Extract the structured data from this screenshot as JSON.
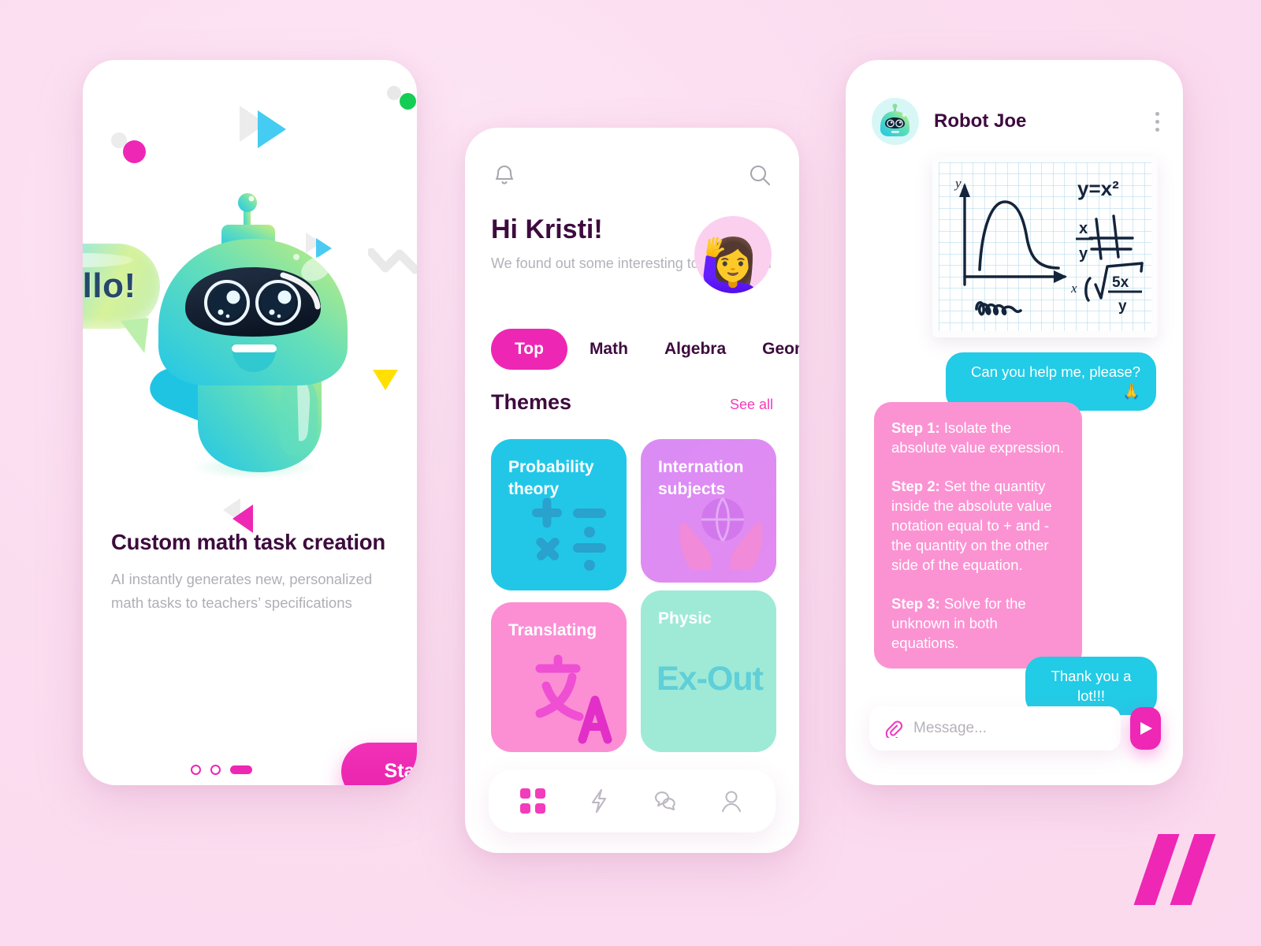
{
  "theme": {
    "background": "#fbdcef",
    "accent_pink": "#ed27b4",
    "deep_purple": "#3d0b3e",
    "cyan": "#22cbe6",
    "bubble_pink": "#fb93d2"
  },
  "onboarding": {
    "speech_bubble": "Hello!",
    "title": "Custom math task creation",
    "subtitle": "AI instantly generates new, personalized math tasks to teachers’ specifications",
    "start_label": "Start",
    "pagination": {
      "total": 3,
      "active_index": 2
    }
  },
  "home": {
    "icons": {
      "bell": "bell-icon",
      "search": "search-icon"
    },
    "greeting_title": "Hi Kristi!",
    "greeting_subtitle": "We found out some interesting topics for you",
    "avatar_emoji": "🙋‍♀️",
    "tabs": [
      {
        "label": "Top",
        "active": true
      },
      {
        "label": "Math",
        "active": false
      },
      {
        "label": "Algebra",
        "active": false
      },
      {
        "label": "Geometry",
        "active": false
      }
    ],
    "section_title": "Themes",
    "see_all_label": "See all",
    "cards": [
      {
        "title": "Probability theory",
        "icon": "math-operators-icon",
        "color": "#22c7e8"
      },
      {
        "title": "Internation subjects",
        "icon": "globe-in-hands-icon",
        "color": "#dc8cf3"
      },
      {
        "title": "Translating",
        "icon": "translate-icon",
        "color": "#fc8fd4"
      },
      {
        "title": "Physic",
        "icon": "ex-out-text",
        "color": "#9eead7",
        "badge_text": "Ex-Out"
      }
    ],
    "nav": [
      {
        "name": "dashboard",
        "icon": "grid-icon",
        "active": true
      },
      {
        "name": "activity",
        "icon": "lightning-icon",
        "active": false
      },
      {
        "name": "chats",
        "icon": "chat-bubbles-icon",
        "active": false
      },
      {
        "name": "profile",
        "icon": "person-icon",
        "active": false
      }
    ]
  },
  "chat": {
    "contact_name": "Robot Joe",
    "avatar_icon": "robot-avatar-icon",
    "menu_icon": "kebab-menu-icon",
    "whiteboard": {
      "alt": "handwritten math notes on graph paper",
      "annotations": [
        "y",
        "x",
        "y=x²",
        "x",
        "y",
        "5x",
        "y"
      ]
    },
    "messages": [
      {
        "from": "me",
        "text": "Can you help me, please? 🙏"
      },
      {
        "from": "bot",
        "html": true,
        "segments": [
          {
            "bold": "Step 1:",
            "text": " Isolate the absolute value expression."
          },
          {
            "bold": "Step 2:",
            "text": " Set the quantity inside the absolute value notation equal to + and - the quantity on the other side of the equation."
          },
          {
            "bold": "Step 3:",
            "text": " Solve for the unknown in both equations."
          }
        ]
      },
      {
        "from": "me",
        "text": "Thank you a lot!!!"
      }
    ],
    "composer": {
      "attach_icon": "paperclip-icon",
      "placeholder": "Message...",
      "value": "",
      "send_icon": "send-icon"
    }
  },
  "branding": {
    "logo": "double-slash-logo"
  }
}
